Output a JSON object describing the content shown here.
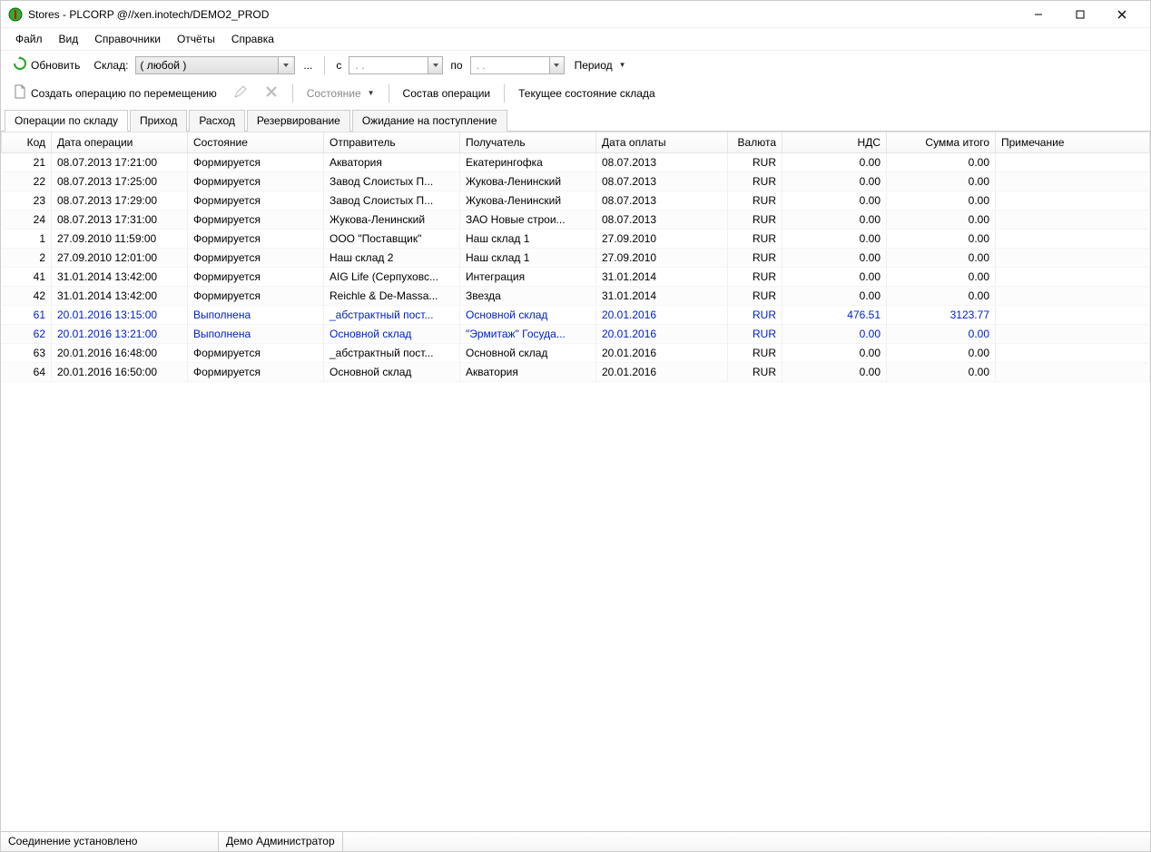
{
  "window": {
    "title": "Stores - PLCORP @//xen.inotech/DEMO2_PROD"
  },
  "menu": {
    "items": [
      "Файл",
      "Вид",
      "Справочники",
      "Отчёты",
      "Справка"
    ]
  },
  "toolbar1": {
    "refresh": "Обновить",
    "sklad_label": "Склад:",
    "sklad_value": "( любой )",
    "dots": "...",
    "from_label": "с",
    "from_value": ".  .",
    "to_label": "по",
    "to_value": ".  .",
    "period": "Период"
  },
  "toolbar2": {
    "create_move": "Создать операцию по перемещению",
    "state": "Состояние",
    "composition": "Состав операции",
    "current_state": "Текущее состояние склада"
  },
  "tabs": {
    "items": [
      "Операции по складу",
      "Приход",
      "Расход",
      "Резервирование",
      "Ожидание на поступление"
    ],
    "active": 0
  },
  "grid": {
    "headers": [
      "Код",
      "Дата операции",
      "Состояние",
      "Отправитель",
      "Получатель",
      "Дата оплаты",
      "Валюта",
      "НДС",
      "Сумма итого",
      "Примечание"
    ],
    "rows": [
      {
        "code": "21",
        "date": "08.07.2013 17:21:00",
        "state": "Формируется",
        "sender": "Акватория",
        "receiver": "Екатерингофка",
        "paydate": "08.07.2013",
        "currency": "RUR",
        "vat": "0.00",
        "total": "0.00",
        "note": "",
        "completed": false
      },
      {
        "code": "22",
        "date": "08.07.2013 17:25:00",
        "state": "Формируется",
        "sender": "Завод Слоистых П...",
        "receiver": "Жукова-Ленинский",
        "paydate": "08.07.2013",
        "currency": "RUR",
        "vat": "0.00",
        "total": "0.00",
        "note": "",
        "completed": false
      },
      {
        "code": "23",
        "date": "08.07.2013 17:29:00",
        "state": "Формируется",
        "sender": "Завод Слоистых П...",
        "receiver": "Жукова-Ленинский",
        "paydate": "08.07.2013",
        "currency": "RUR",
        "vat": "0.00",
        "total": "0.00",
        "note": "",
        "completed": false
      },
      {
        "code": "24",
        "date": "08.07.2013 17:31:00",
        "state": "Формируется",
        "sender": "Жукова-Ленинский",
        "receiver": "ЗАО  Новые строи...",
        "paydate": "08.07.2013",
        "currency": "RUR",
        "vat": "0.00",
        "total": "0.00",
        "note": "",
        "completed": false
      },
      {
        "code": "1",
        "date": "27.09.2010 11:59:00",
        "state": "Формируется",
        "sender": "ООО \"Поставщик\"",
        "receiver": "Наш склад 1",
        "paydate": "27.09.2010",
        "currency": "RUR",
        "vat": "0.00",
        "total": "0.00",
        "note": "",
        "completed": false
      },
      {
        "code": "2",
        "date": "27.09.2010 12:01:00",
        "state": "Формируется",
        "sender": "Наш склад 2",
        "receiver": "Наш склад 1",
        "paydate": "27.09.2010",
        "currency": "RUR",
        "vat": "0.00",
        "total": "0.00",
        "note": "",
        "completed": false
      },
      {
        "code": "41",
        "date": "31.01.2014 13:42:00",
        "state": "Формируется",
        "sender": "AIG Life (Серпуховс...",
        "receiver": "Интеграция",
        "paydate": "31.01.2014",
        "currency": "RUR",
        "vat": "0.00",
        "total": "0.00",
        "note": "",
        "completed": false
      },
      {
        "code": "42",
        "date": "31.01.2014 13:42:00",
        "state": "Формируется",
        "sender": "Reichle & De-Massa...",
        "receiver": "Звезда",
        "paydate": "31.01.2014",
        "currency": "RUR",
        "vat": "0.00",
        "total": "0.00",
        "note": "",
        "completed": false
      },
      {
        "code": "61",
        "date": "20.01.2016 13:15:00",
        "state": "Выполнена",
        "sender": "_абстрактный пост...",
        "receiver": "Основной склад",
        "paydate": "20.01.2016",
        "currency": "RUR",
        "vat": "476.51",
        "total": "3123.77",
        "note": "",
        "completed": true
      },
      {
        "code": "62",
        "date": "20.01.2016 13:21:00",
        "state": "Выполнена",
        "sender": "Основной склад",
        "receiver": "\"Эрмитаж\" Госуда...",
        "paydate": "20.01.2016",
        "currency": "RUR",
        "vat": "0.00",
        "total": "0.00",
        "note": "",
        "completed": true
      },
      {
        "code": "63",
        "date": "20.01.2016 16:48:00",
        "state": "Формируется",
        "sender": "_абстрактный пост...",
        "receiver": "Основной склад",
        "paydate": "20.01.2016",
        "currency": "RUR",
        "vat": "0.00",
        "total": "0.00",
        "note": "",
        "completed": false
      },
      {
        "code": "64",
        "date": "20.01.2016 16:50:00",
        "state": "Формируется",
        "sender": "Основной склад",
        "receiver": "Акватория",
        "paydate": "20.01.2016",
        "currency": "RUR",
        "vat": "0.00",
        "total": "0.00",
        "note": "",
        "completed": false
      }
    ]
  },
  "statusbar": {
    "connection": "Соединение установлено",
    "user": "Демо Администратор"
  }
}
